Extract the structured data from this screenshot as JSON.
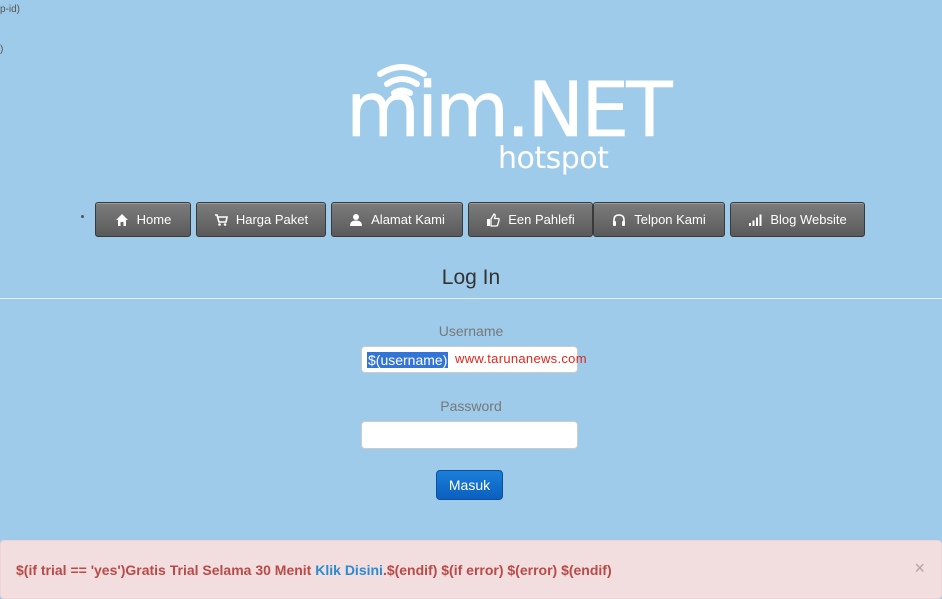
{
  "stray_text": {
    "line1": "p-id)",
    "line2": ")"
  },
  "logo": {
    "main": "mim.NET",
    "sub": "hotspot",
    "icon": "wifi-signal-icon"
  },
  "nav": {
    "items": [
      {
        "label": "Home",
        "icon": "home-icon"
      },
      {
        "label": "Harga Paket",
        "icon": "cart-icon"
      },
      {
        "label": "Alamat Kami",
        "icon": "user-icon"
      },
      {
        "label": "Een Pahlefi",
        "icon": "thumbs-up-icon"
      },
      {
        "label": "Telpon Kami",
        "icon": "headphones-icon"
      },
      {
        "label": "Blog Website",
        "icon": "signal-bars-icon"
      }
    ]
  },
  "login": {
    "title": "Log In",
    "username_label": "Username",
    "username_value": "$(username)",
    "password_label": "Password",
    "password_value": "",
    "submit_label": "Masuk"
  },
  "watermark": "www.tarunanews.com",
  "alert": {
    "prefix": "$(if trial == 'yes')Gratis Trial Selama 30 Menit ",
    "link": "Klik Disini",
    "suffix": ".$(endif) $(if error) $(error) $(endif)",
    "close": "×"
  },
  "colors": {
    "background": "#9fcbeb",
    "nav_button": "#6b6b6b",
    "primary_button": "#0e6fcc",
    "alert_bg": "#f2dede",
    "alert_text": "#b94a48",
    "alert_link": "#2a8ad2",
    "watermark": "#e0261b"
  }
}
